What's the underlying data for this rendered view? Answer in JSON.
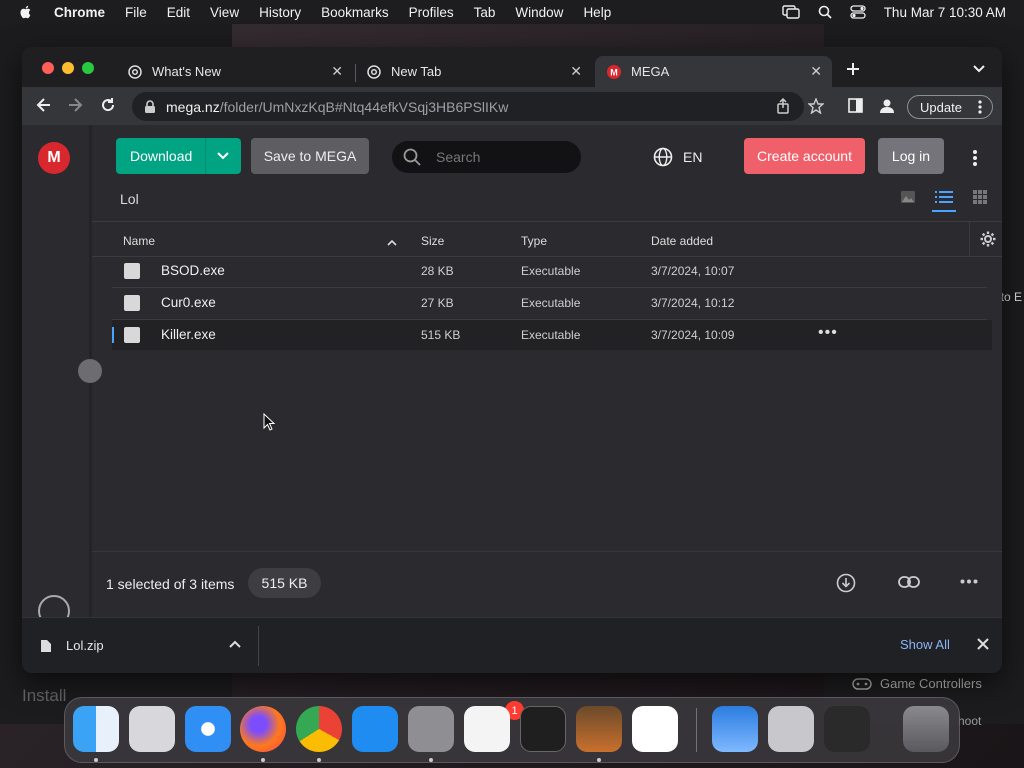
{
  "menubar": {
    "app": "Chrome",
    "items": [
      "File",
      "Edit",
      "View",
      "History",
      "Bookmarks",
      "Profiles",
      "Tab",
      "Window",
      "Help"
    ],
    "datetime": "Thu Mar 7  10:30 AM"
  },
  "tabs": [
    {
      "title": "What's New",
      "icon": "chrome-icon"
    },
    {
      "title": "New Tab",
      "icon": "chrome-icon"
    },
    {
      "title": "MEGA",
      "icon": "mega-icon",
      "active": true
    }
  ],
  "address": {
    "host": "mega.nz",
    "path": "/folder/UmNxzKqB#Ntq44efkVSqj3HB6PSlIKw"
  },
  "update_label": "Update",
  "mega": {
    "download_label": "Download",
    "save_label": "Save to MEGA",
    "search_placeholder": "Search",
    "lang": "EN",
    "create_label": "Create account",
    "login_label": "Log in",
    "breadcrumb": "Lol",
    "columns": {
      "name": "Name",
      "size": "Size",
      "type": "Type",
      "date": "Date added"
    },
    "files": [
      {
        "name": "BSOD.exe",
        "size": "28 KB",
        "type": "Executable",
        "date": "3/7/2024, 10:07"
      },
      {
        "name": "Cur0.exe",
        "size": "27 KB",
        "type": "Executable",
        "date": "3/7/2024, 10:12"
      },
      {
        "name": "Killer.exe",
        "size": "515 KB",
        "type": "Executable",
        "date": "3/7/2024, 10:09",
        "selected": true
      }
    ],
    "status": "1 selected of 3 items",
    "selected_size": "515 KB",
    "more": "•••"
  },
  "downloads": {
    "file": "Lol.zip",
    "show_all": "Show All"
  },
  "background": {
    "right_text": "to E",
    "game_controllers": "Game Controllers",
    "install": "Install",
    "shoot": "hoot"
  },
  "dock": {
    "badge": "1"
  },
  "colors": {
    "accent_green": "#00a382",
    "mega_red": "#d9272e",
    "create_pink": "#f0606a",
    "link_blue": "#8ab4f8"
  }
}
